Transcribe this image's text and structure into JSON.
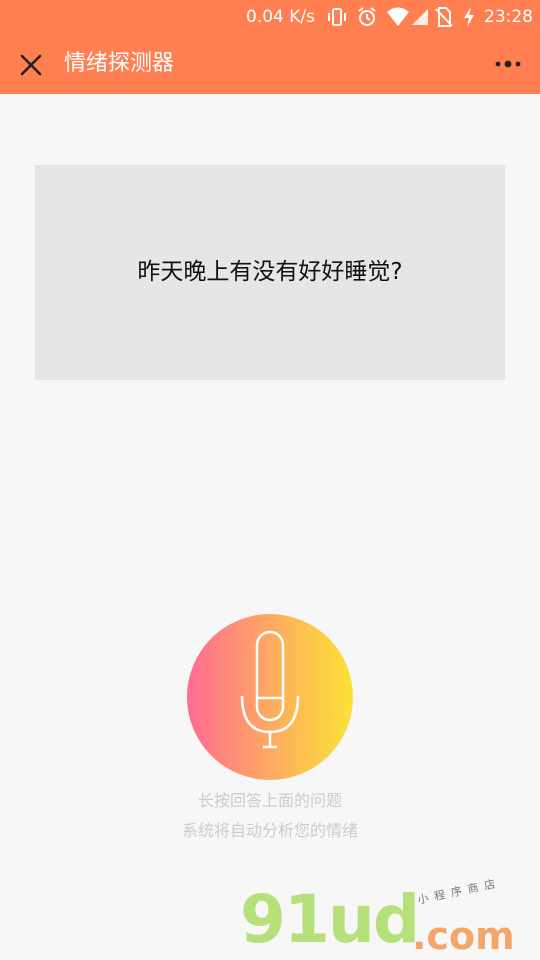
{
  "status_bar": {
    "network_speed": "0.04 K/s",
    "time": "23:28",
    "icons": [
      "vibrate-icon",
      "alarm-icon",
      "wifi-icon",
      "signal-icon",
      "no-sim-icon",
      "charging-icon"
    ]
  },
  "header": {
    "title": "情绪探测器",
    "close_icon": "close-icon",
    "more_icon": "more-icon",
    "background_color": "#ff7f50"
  },
  "question": {
    "text": "昨天晚上有没有好好睡觉?"
  },
  "mic": {
    "icon": "microphone-icon",
    "gradient_colors": [
      "#ff6b92",
      "#fdc24e",
      "#fbe138"
    ]
  },
  "hints": {
    "line1": "长按回答上面的问题",
    "line2": "系统将自动分析您的情绪"
  },
  "watermark": {
    "brand": "91ud",
    "domain": ".com",
    "tagline": "小程序商店"
  }
}
